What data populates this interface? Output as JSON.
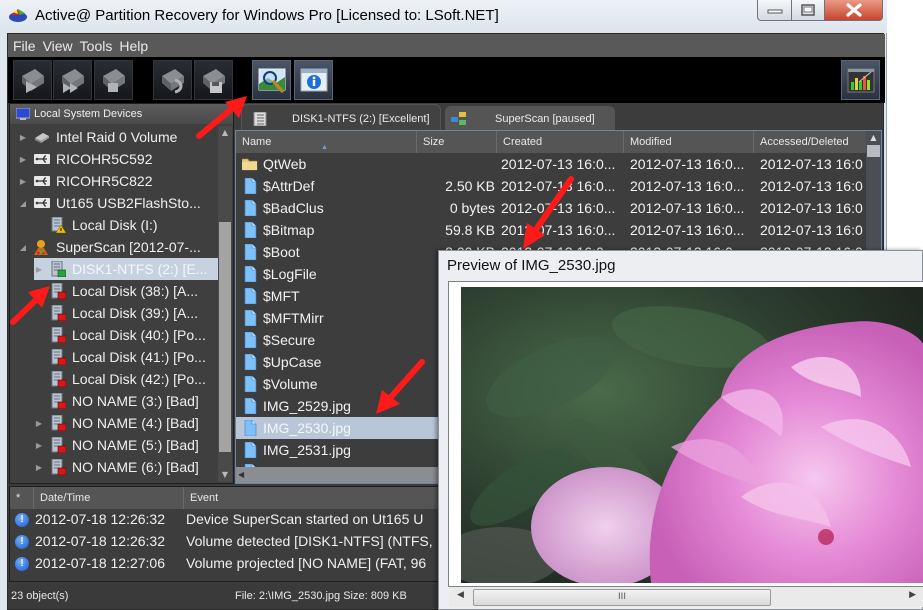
{
  "window": {
    "title": "Active@ Partition Recovery for Windows Pro [Licensed to: LSoft.NET]",
    "controls": {
      "minimize": "minimize",
      "maximize": "maximize",
      "close": "close"
    }
  },
  "menu": [
    "File",
    "View",
    "Tools",
    "Help"
  ],
  "toolbar": {
    "buttons": [
      {
        "name": "scan-disk",
        "icon": "disk-play-icon"
      },
      {
        "name": "superscan",
        "icon": "disk-fastforward-icon"
      },
      {
        "name": "stop-scan",
        "icon": "disk-stop-icon"
      },
      {
        "name": "recover",
        "icon": "disk-recover-icon"
      },
      {
        "name": "save-scan",
        "icon": "disk-save-icon"
      },
      {
        "name": "preview",
        "icon": "image-magnifier-icon"
      },
      {
        "name": "properties",
        "icon": "info-window-icon"
      },
      {
        "name": "monitor",
        "icon": "equalizer-chart-icon"
      }
    ]
  },
  "tree": {
    "header": "Local System Devices",
    "items": [
      {
        "label": "Intel   Raid 0 Volume",
        "icon": "raid-disk-icon",
        "twisty": "collapsed",
        "level": 0
      },
      {
        "label": "RICOHR5C592",
        "icon": "usb-icon",
        "twisty": "collapsed",
        "level": 0
      },
      {
        "label": "RICOHR5C822",
        "icon": "usb-icon",
        "twisty": "collapsed",
        "level": 0
      },
      {
        "label": "Ut165   USB2FlashSto...",
        "icon": "usb-icon",
        "twisty": "expanded",
        "level": 0
      },
      {
        "label": "Local Disk (I:)",
        "icon": "volume-warning-icon",
        "twisty": "none",
        "level": 1
      },
      {
        "label": "SuperScan [2012-07-...",
        "icon": "superscan-icon",
        "twisty": "expanded",
        "level": 0
      },
      {
        "label": "DISK1-NTFS (2:) [E...",
        "icon": "volume-green-icon",
        "twisty": "collapsed",
        "level": 1,
        "selected": true
      },
      {
        "label": "Local Disk (38:) [A...",
        "icon": "volume-red-icon",
        "twisty": "none",
        "level": 1
      },
      {
        "label": "Local Disk (39:) [A...",
        "icon": "volume-red-icon",
        "twisty": "none",
        "level": 1
      },
      {
        "label": "Local Disk (40:) [Po...",
        "icon": "volume-red-icon",
        "twisty": "none",
        "level": 1
      },
      {
        "label": "Local Disk (41:) [Po...",
        "icon": "volume-red-icon",
        "twisty": "none",
        "level": 1
      },
      {
        "label": "Local Disk (42:) [Po...",
        "icon": "volume-red-icon",
        "twisty": "none",
        "level": 1
      },
      {
        "label": "NO NAME (3:) [Bad]",
        "icon": "volume-red-icon",
        "twisty": "none",
        "level": 1
      },
      {
        "label": "NO NAME (4:) [Bad]",
        "icon": "volume-red-icon",
        "twisty": "collapsed",
        "level": 1
      },
      {
        "label": "NO NAME (5:) [Bad]",
        "icon": "volume-red-icon",
        "twisty": "collapsed",
        "level": 1
      },
      {
        "label": "NO NAME (6:) [Bad]",
        "icon": "volume-red-icon",
        "twisty": "collapsed",
        "level": 1
      }
    ]
  },
  "tabs": [
    {
      "label": "DISK1-NTFS (2:) [Excellent]",
      "icon": "volume-list-icon",
      "active": true
    },
    {
      "label": "SuperScan [paused]",
      "icon": "superscan-network-icon",
      "active": false
    }
  ],
  "files": {
    "columns": [
      "Name",
      "Size",
      "Created",
      "Modified",
      "Accessed/Deleted"
    ],
    "sort_column": "Name",
    "rows": [
      {
        "name": "QtWeb",
        "type": "folder",
        "size": "",
        "created": "2012-07-13 16:0...",
        "modified": "2012-07-13 16:0...",
        "accessed": "2012-07-13 16:0"
      },
      {
        "name": "$AttrDef",
        "type": "file",
        "size": "2.50 KB",
        "created": "2012-07-13 16:0...",
        "modified": "2012-07-13 16:0...",
        "accessed": "2012-07-13 16:0"
      },
      {
        "name": "$BadClus",
        "type": "file",
        "size": "0 bytes",
        "created": "2012-07-13 16:0...",
        "modified": "2012-07-13 16:0...",
        "accessed": "2012-07-13 16:0"
      },
      {
        "name": "$Bitmap",
        "type": "file",
        "size": "59.8 KB",
        "created": "2012-07-13 16:0...",
        "modified": "2012-07-13 16:0...",
        "accessed": "2012-07-13 16:0"
      },
      {
        "name": "$Boot",
        "type": "file",
        "size": "8.00 KB",
        "created": "2012-07-13 16:0...",
        "modified": "2012-07-13 16:0...",
        "accessed": "2012-07-13 16:0"
      },
      {
        "name": "$LogFile",
        "type": "file",
        "size": "",
        "created": "",
        "modified": "",
        "accessed": ""
      },
      {
        "name": "$MFT",
        "type": "file",
        "size": "",
        "created": "",
        "modified": "",
        "accessed": ""
      },
      {
        "name": "$MFTMirr",
        "type": "file",
        "size": "",
        "created": "",
        "modified": "",
        "accessed": ""
      },
      {
        "name": "$Secure",
        "type": "file",
        "size": "",
        "created": "",
        "modified": "",
        "accessed": ""
      },
      {
        "name": "$UpCase",
        "type": "file",
        "size": "",
        "created": "",
        "modified": "",
        "accessed": ""
      },
      {
        "name": "$Volume",
        "type": "file",
        "size": "",
        "created": "",
        "modified": "",
        "accessed": ""
      },
      {
        "name": "IMG_2529.jpg",
        "type": "file",
        "size": "",
        "created": "",
        "modified": "",
        "accessed": ""
      },
      {
        "name": "IMG_2530.jpg",
        "type": "file",
        "size": "",
        "created": "",
        "modified": "",
        "accessed": "",
        "selected": true
      },
      {
        "name": "IMG_2531.jpg",
        "type": "file",
        "size": "",
        "created": "",
        "modified": "",
        "accessed": ""
      },
      {
        "name": "IMG_2532.jpg",
        "type": "file",
        "size": "",
        "created": "",
        "modified": "",
        "accessed": ""
      }
    ]
  },
  "log": {
    "columns": [
      "*",
      "Date/Time",
      "Event"
    ],
    "rows": [
      {
        "datetime": "2012-07-18 12:26:32",
        "event": "Device SuperScan started on Ut165   U"
      },
      {
        "datetime": "2012-07-18 12:26:32",
        "event": "Volume detected [DISK1-NTFS] (NTFS,"
      },
      {
        "datetime": "2012-07-18 12:27:06",
        "event": "Volume projected [NO NAME] (FAT, 96"
      }
    ]
  },
  "status": {
    "objects": "23 object(s)",
    "file_info": "File: 2:\\IMG_2530.jpg  Size: 809 KB"
  },
  "preview": {
    "title": "Preview of IMG_2530.jpg",
    "image_subject": "pink peony flower with green leaves",
    "scroll_thumb_glyph": "III"
  },
  "colors": {
    "dark_bg": "#3d3d3d",
    "selection": "#b9c6d8",
    "annotation_arrow": "#ff1a1a",
    "close_button": "#c8442c"
  }
}
